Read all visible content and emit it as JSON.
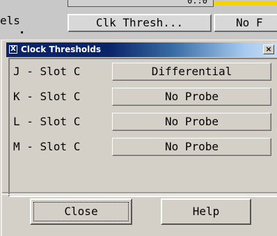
{
  "background_app": {
    "partial_label": "els",
    "sliver_text": "0.:0",
    "buttons": [
      "Clk Thresh...",
      "No F"
    ]
  },
  "dialog": {
    "title": "Clock Thresholds",
    "icon_glyph": "X",
    "close_glyph": "×",
    "rows": [
      {
        "label": "J - Slot C",
        "probe": "Differential"
      },
      {
        "label": "K - Slot C",
        "probe": "No Probe"
      },
      {
        "label": "L - Slot C",
        "probe": "No Probe"
      },
      {
        "label": "M - Slot C",
        "probe": "No Probe"
      }
    ],
    "close_label": "Close",
    "help_label": "Help"
  },
  "colors": {
    "titlebar_start": "#0a246a",
    "titlebar_end": "#a6caf0",
    "face": "#d4d0c8",
    "highlight_yellow": "#f4d400"
  }
}
